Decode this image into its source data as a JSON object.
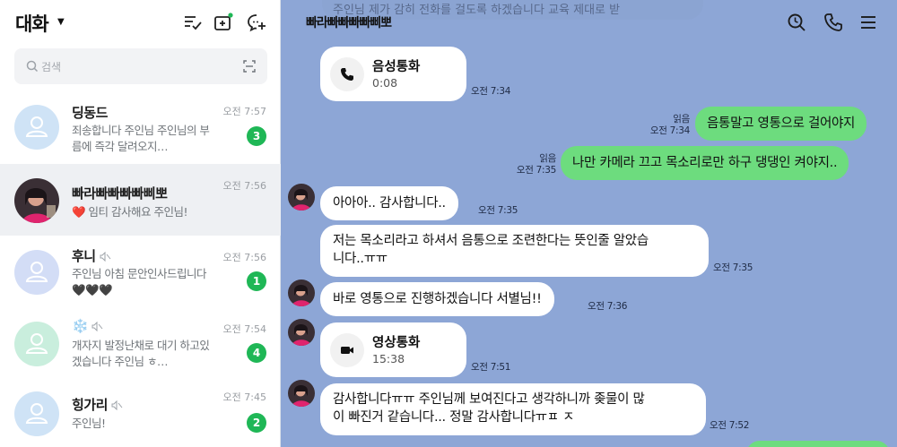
{
  "sidebar": {
    "title": "대화",
    "search_placeholder": "검색",
    "chats": [
      {
        "name": "딩동드",
        "preview": "죄송합니다 주인님 주인님의 부름에 즉각 달려오지…",
        "time": "오전 7:57",
        "badge": "3",
        "muted": false
      },
      {
        "name": "빠라빠빠빠빠삐뽀",
        "preview": "❤️ 임티 감사해요 주인님!",
        "time": "오전 7:56",
        "badge": "",
        "muted": false,
        "selected": true
      },
      {
        "name": "후니",
        "preview": "주인님 아침 문안인사드립니다🖤🖤🖤",
        "time": "오전 7:56",
        "badge": "1",
        "muted": true
      },
      {
        "name": "❄️",
        "preview": "개자지 발정난채로 대기 하고있겠습니다 주인님 ㅎ…",
        "time": "오전 7:54",
        "badge": "4",
        "muted": true
      },
      {
        "name": "힝가리",
        "preview": "주인님!",
        "time": "오전 7:45",
        "badge": "2",
        "muted": true
      }
    ],
    "colors": {
      "badge": "#1fb756",
      "avatar_default": "#cfe3f6"
    }
  },
  "chat": {
    "title": "빠라빠빠빠빠삐뽀",
    "top_cut_text": "주인님 제가 감히 전화를 걸도록 하겠습니다 교육 제대로 받",
    "messages": [
      {
        "type": "call",
        "side": "other",
        "label": "음성통화",
        "duration": "0:08",
        "time": "오전 7:34"
      },
      {
        "type": "text",
        "side": "me",
        "text": "음통말고 영통으로 걸어야지",
        "read": "읽음",
        "time": "오전 7:34"
      },
      {
        "type": "text",
        "side": "me",
        "text": "나만 카메라 끄고 목소리로만 하구 댕댕인 켜야지..",
        "read": "읽음",
        "time": "오전 7:35"
      },
      {
        "type": "text",
        "side": "other",
        "text": "아아아.. 감사합니다..",
        "time": "오전 7:35"
      },
      {
        "type": "text",
        "side": "other",
        "line1": "저는 목소리라고 하셔서 음통으로 조련한다는 뜻인줄 알았습",
        "line2": "니다..ㅠㅠ",
        "time": "오전 7:35"
      },
      {
        "type": "text",
        "side": "other",
        "text": "바로 영통으로 진행하겠습니다 서별님!!",
        "time": "오전 7:36"
      },
      {
        "type": "call",
        "side": "other",
        "label": "영상통화",
        "duration": "15:38",
        "time": "오전 7:51"
      },
      {
        "type": "text",
        "side": "other",
        "line1": "감사합니다ㅠㅠ 주인님께 보여진다고 생각하니까 좆물이 많",
        "line2": "이 빠진거 같습니다... 정말 감사합니다ㅠㅍ ㅈ",
        "time": "오전 7:52"
      }
    ],
    "colors": {
      "background": "#8da6d6",
      "my_bubble": "#6ddc7e",
      "other_bubble": "#ffffff"
    }
  }
}
